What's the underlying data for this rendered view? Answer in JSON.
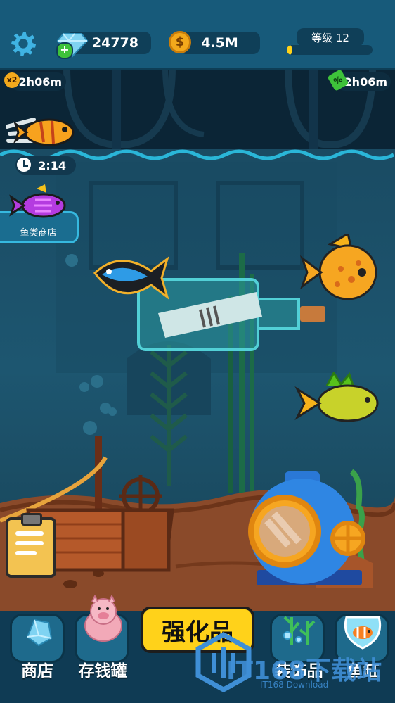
{
  "top_bar": {
    "gems": "24778",
    "coins": "4.5M",
    "level_label": "等级 12",
    "level_progress": 0.06
  },
  "timers": {
    "double_bonus_badge": "x2",
    "double_bonus_time": "22h06m",
    "discount_badge": "%",
    "discount_time": "22h06m",
    "fish_timer": "2:14"
  },
  "side": {
    "fish_shop_label": "鱼类商店"
  },
  "bottom_nav": {
    "shop": "商店",
    "piggy_bank": "存钱罐",
    "upgrade": "强化品",
    "decor": "装饰品",
    "fish_tank": "鱼缸"
  },
  "watermark": {
    "text": "IT168下载站",
    "subtext": "IT168 Download"
  },
  "colors": {
    "accent_yellow": "#ffd21a",
    "bar_blue": "#175a7a",
    "sand": "#8a4a2a"
  }
}
